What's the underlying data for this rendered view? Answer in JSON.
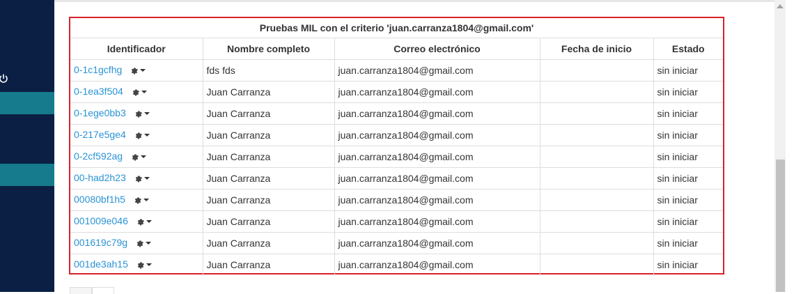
{
  "sidebar": {
    "icons": {
      "power": "power-icon"
    },
    "colors": {
      "background": "#0b1f44",
      "active": "#167b8c"
    }
  },
  "table": {
    "caption": "Pruebas MIL con el criterio 'juan.carranza1804@gmail.com'",
    "border_color": "#d9202a",
    "link_color": "#2a93d5",
    "columns": [
      "Identificador",
      "Nombre completo",
      "Correo electrónico",
      "Fecha de inicio",
      "Estado"
    ],
    "rows": [
      {
        "id": "0-1c1gcfhg",
        "name": "fds fds",
        "email": "juan.carranza1804@gmail.com",
        "start": "",
        "status": "sin iniciar"
      },
      {
        "id": "0-1ea3f504",
        "name": "Juan Carranza",
        "email": "juan.carranza1804@gmail.com",
        "start": "",
        "status": "sin iniciar"
      },
      {
        "id": "0-1ege0bb3",
        "name": "Juan Carranza",
        "email": "juan.carranza1804@gmail.com",
        "start": "",
        "status": "sin iniciar"
      },
      {
        "id": "0-217e5ge4",
        "name": "Juan Carranza",
        "email": "juan.carranza1804@gmail.com",
        "start": "",
        "status": "sin iniciar"
      },
      {
        "id": "0-2cf592ag",
        "name": "Juan Carranza",
        "email": "juan.carranza1804@gmail.com",
        "start": "",
        "status": "sin iniciar"
      },
      {
        "id": "00-had2h23",
        "name": "Juan Carranza",
        "email": "juan.carranza1804@gmail.com",
        "start": "",
        "status": "sin iniciar"
      },
      {
        "id": "00080bf1h5",
        "name": "Juan Carranza",
        "email": "juan.carranza1804@gmail.com",
        "start": "",
        "status": "sin iniciar"
      },
      {
        "id": "001009e046",
        "name": "Juan Carranza",
        "email": "juan.carranza1804@gmail.com",
        "start": "",
        "status": "sin iniciar"
      },
      {
        "id": "001619c79g",
        "name": "Juan Carranza",
        "email": "juan.carranza1804@gmail.com",
        "start": "",
        "status": "sin iniciar"
      },
      {
        "id": "001de3ah15",
        "name": "Juan Carranza",
        "email": "juan.carranza1804@gmail.com",
        "start": "",
        "status": "sin iniciar"
      }
    ],
    "row_action_icon": "gear-icon"
  }
}
